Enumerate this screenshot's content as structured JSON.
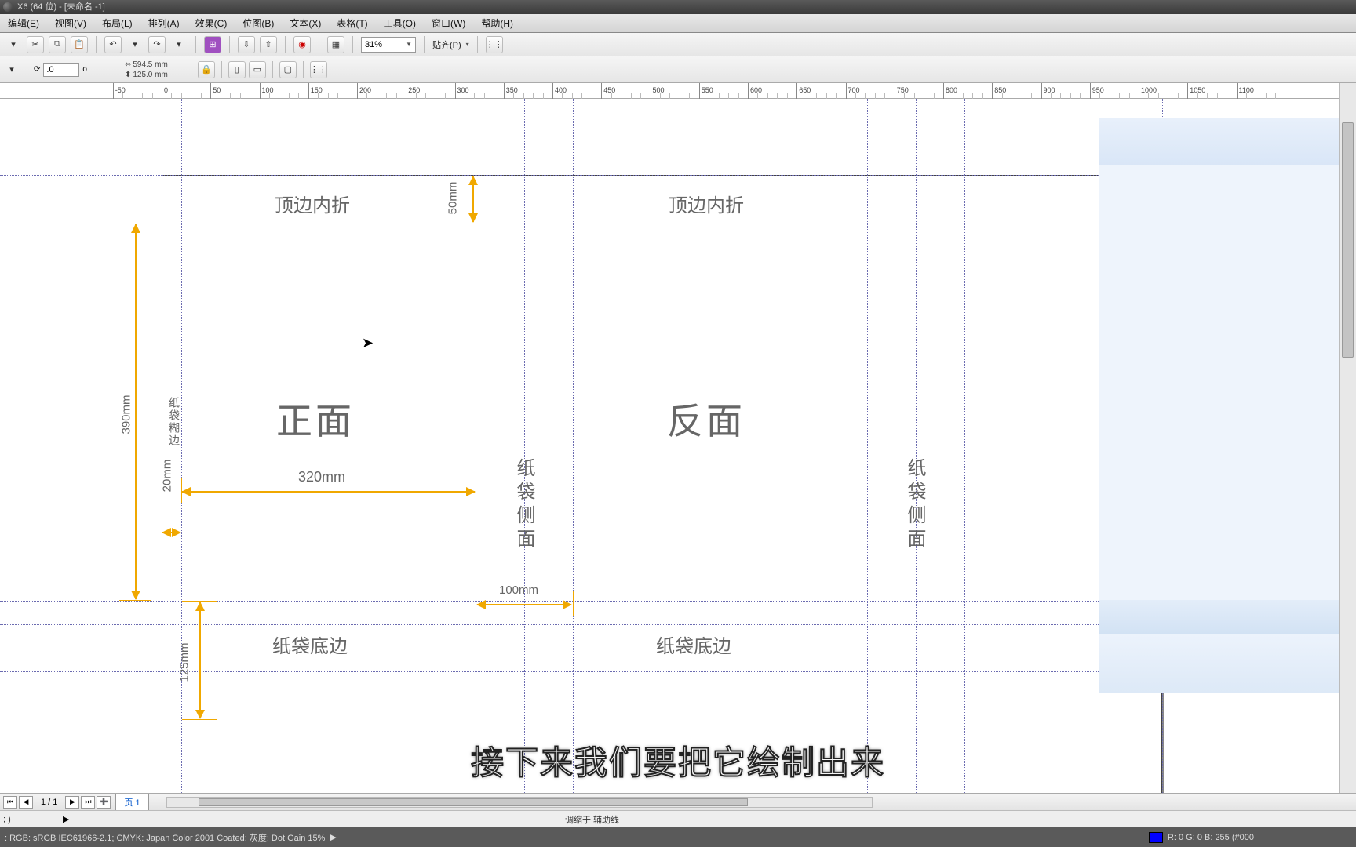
{
  "title_bar": "X6 (64 位) - [未命名 -1]",
  "menu": [
    "编辑(E)",
    "视图(V)",
    "布局(L)",
    "排列(A)",
    "效果(C)",
    "位图(B)",
    "文本(X)",
    "表格(T)",
    "工具(O)",
    "窗口(W)",
    "帮助(H)"
  ],
  "toolbar": {
    "zoom_value": "31%",
    "snap_label": "贴齐(P)",
    "dims": {
      "w": "594.5 mm",
      "h": "125.0 mm"
    },
    "rotation": ".0",
    "deg": "o"
  },
  "ruler_ticks": [
    -50,
    0,
    50,
    100,
    150,
    200,
    250,
    300,
    350,
    400,
    450,
    500,
    550,
    600,
    650,
    700,
    750,
    800,
    850,
    900,
    950,
    1000,
    1050,
    1100
  ],
  "canvas": {
    "front_title": "正面",
    "back_title": "反面",
    "top_fold_1": "顶边内折",
    "top_fold_2": "顶边内折",
    "side_1": "纸袋侧面",
    "side_2": "纸袋侧面",
    "glue_edge": "纸袋糊边",
    "bottom_1": "纸袋底边",
    "bottom_2": "纸袋底边",
    "dim_top": "50mm",
    "dim_height": "390mm",
    "dim_glue": "20mm",
    "dim_width": "320mm",
    "dim_side": "100mm",
    "dim_bottom": "125mm"
  },
  "subtitle": "接下来我们要把它绘制出来",
  "tabbar": {
    "page_counter": "1 / 1",
    "page_tab": "页 1"
  },
  "footer": {
    "coord": "; )",
    "hint": "调缩于 辅助线",
    "color_profile": ": RGB: sRGB IEC61966-2.1; CMYK: Japan Color 2001 Coated; 灰度: Dot Gain 15%",
    "rgb_readout": "R: 0 G: 0 B: 255 (#000"
  }
}
